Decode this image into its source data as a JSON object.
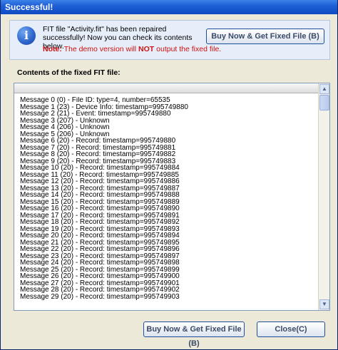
{
  "window": {
    "title": "Successful!"
  },
  "info": {
    "message": "FIT file \"Activity.fit\" has been repaired successfully! Now you can check its contents below.",
    "note_label": "Note:",
    "note_prefix": "The demo version will ",
    "note_emphasis": "NOT",
    "note_suffix": " output the fixed file."
  },
  "buttons": {
    "buy_top": "Buy Now & Get Fixed File (B)",
    "buy_bottom": "Buy Now & Get Fixed File (B)",
    "close": "Close(C)"
  },
  "contents": {
    "label": "Contents of the fixed FIT file:",
    "lines": [
      "Message 0 (0) - File ID: type=4, number=65535",
      "Message 1 (23) - Device Info: timestamp=995749880",
      "Message 2 (21) - Event: timestamp=995749880",
      "Message 3 (207) - Unknown",
      "Message 4 (206) - Unknown",
      "Message 5 (206) - Unknown",
      "Message 6 (20) - Record: timestamp=995749880",
      "Message 7 (20) - Record: timestamp=995749881",
      "Message 8 (20) - Record: timestamp=995749882",
      "Message 9 (20) - Record: timestamp=995749883",
      "Message 10 (20) - Record: timestamp=995749884",
      "Message 11 (20) - Record: timestamp=995749885",
      "Message 12 (20) - Record: timestamp=995749886",
      "Message 13 (20) - Record: timestamp=995749887",
      "Message 14 (20) - Record: timestamp=995749888",
      "Message 15 (20) - Record: timestamp=995749889",
      "Message 16 (20) - Record: timestamp=995749890",
      "Message 17 (20) - Record: timestamp=995749891",
      "Message 18 (20) - Record: timestamp=995749892",
      "Message 19 (20) - Record: timestamp=995749893",
      "Message 20 (20) - Record: timestamp=995749894",
      "Message 21 (20) - Record: timestamp=995749895",
      "Message 22 (20) - Record: timestamp=995749896",
      "Message 23 (20) - Record: timestamp=995749897",
      "Message 24 (20) - Record: timestamp=995749898",
      "Message 25 (20) - Record: timestamp=995749899",
      "Message 26 (20) - Record: timestamp=995749900",
      "Message 27 (20) - Record: timestamp=995749901",
      "Message 28 (20) - Record: timestamp=995749902",
      "Message 29 (20) - Record: timestamp=995749903"
    ]
  },
  "icons": {
    "info": "info-icon",
    "scroll_up": "chevron-up-icon",
    "scroll_down": "chevron-down-icon"
  },
  "colors": {
    "titlebar": "#1e5fd6",
    "note": "#d01010",
    "info_panel": "#e6eef9"
  }
}
